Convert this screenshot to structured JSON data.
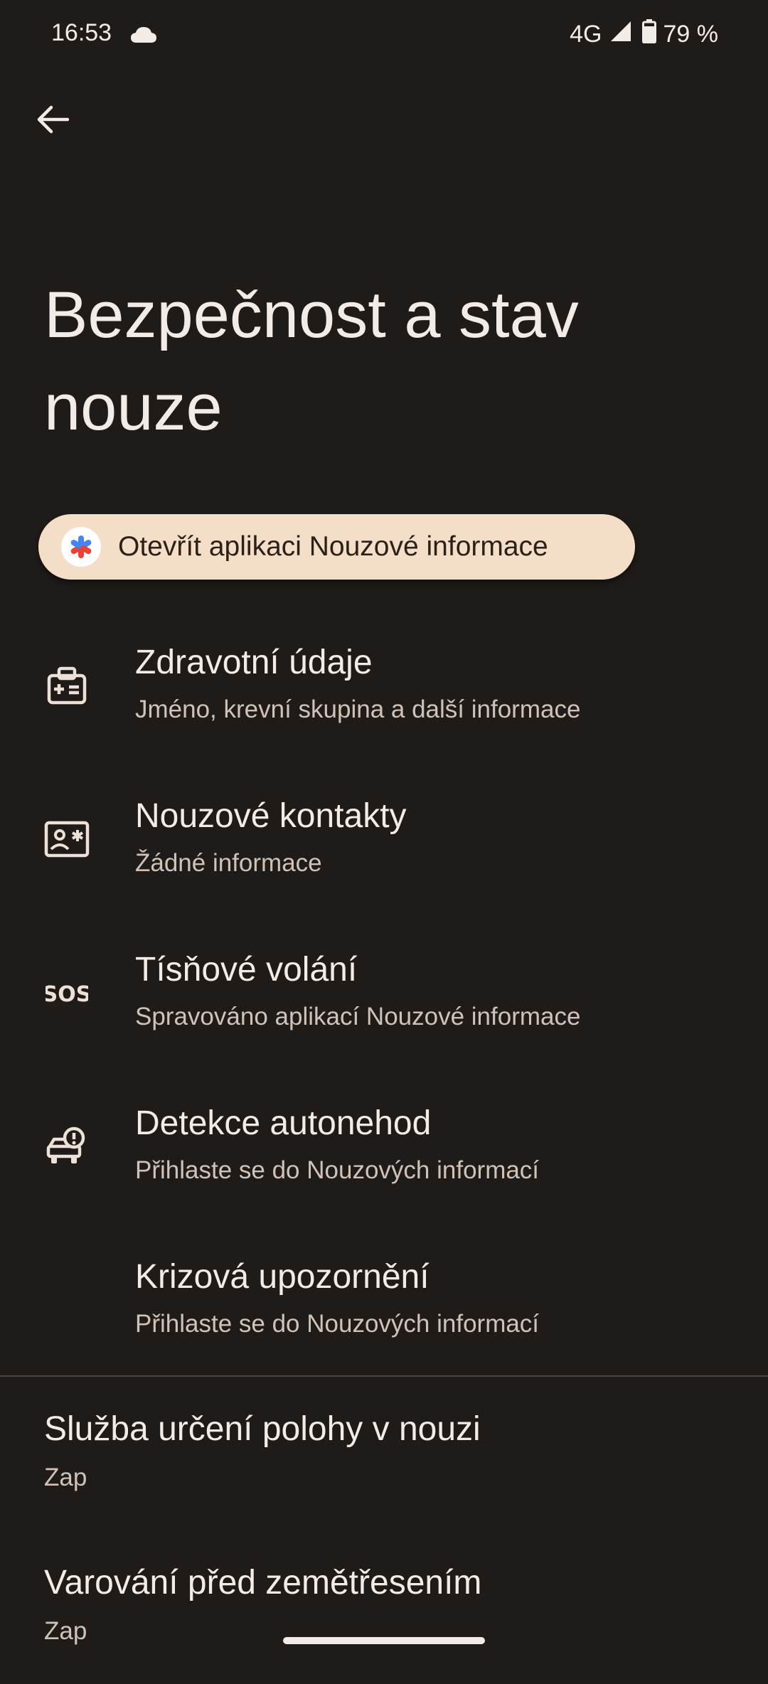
{
  "status": {
    "time": "16:53",
    "network": "4G",
    "battery": "79 %"
  },
  "page": {
    "title": "Bezpečnost a stav nouze"
  },
  "chip": {
    "label": "Otevřít aplikaci Nouzové informace"
  },
  "items": [
    {
      "title": "Zdravotní údaje",
      "subtitle": "Jméno, krevní skupina a další informace",
      "icon": "medical-id-icon"
    },
    {
      "title": "Nouzové kontakty",
      "subtitle": "Žádné informace",
      "icon": "contact-card-icon"
    },
    {
      "title": "Tísňové volání",
      "subtitle": "Spravováno aplikací Nouzové informace",
      "icon": "sos-icon"
    },
    {
      "title": "Detekce autonehod",
      "subtitle": "Přihlaste se do Nouzových informací",
      "icon": "car-crash-icon"
    },
    {
      "title": "Krizová upozornění",
      "subtitle": "Přihlaste se do Nouzových informací",
      "icon": ""
    }
  ],
  "settings": [
    {
      "title": "Služba určení polohy v nouzi",
      "subtitle": "Zap"
    },
    {
      "title": "Varování před zemětřesením",
      "subtitle": "Zap"
    }
  ],
  "colors": {
    "background": "#1f1b18",
    "chip_background": "#f5dec8",
    "text_primary": "#f3ebe5",
    "text_secondary": "#cfc3b9"
  }
}
